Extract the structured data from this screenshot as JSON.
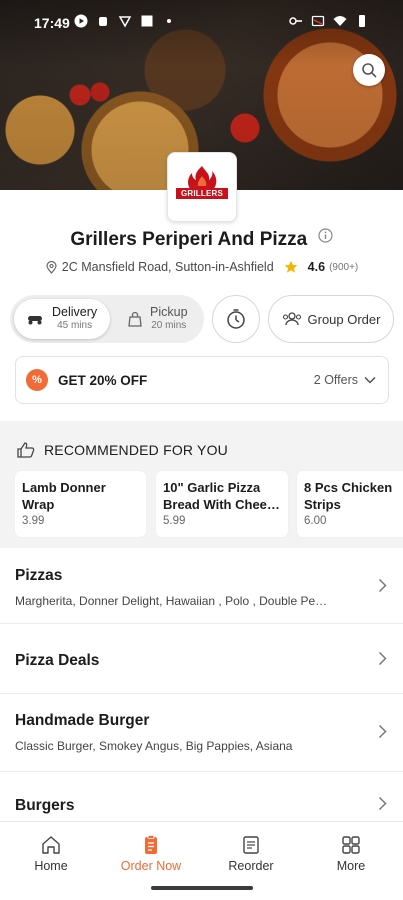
{
  "status_bar": {
    "time": "17:49",
    "left_icons": [
      "play-icon",
      "cloud-icon",
      "shield-icon",
      "square-icon",
      "dot-icon"
    ],
    "right_icons": [
      "key-icon",
      "cast-icon",
      "wifi-icon",
      "battery-icon"
    ]
  },
  "header": {
    "search_icon": "search-icon",
    "logo_text": "GRILLERS"
  },
  "restaurant": {
    "name": "Grillers Periperi And Pizza",
    "address": "2C Mansfield Road, Sutton-in-Ashfield",
    "rating": "4.6",
    "rating_count": "(900+)"
  },
  "order_mode": {
    "delivery_label": "Delivery",
    "delivery_time": "45 mins",
    "pickup_label": "Pickup",
    "pickup_time": "20 mins",
    "selected": "Delivery",
    "group_order_label": "Group Order"
  },
  "offer": {
    "badge": "%",
    "title": "GET 20% OFF",
    "count_label": "2 Offers"
  },
  "recommended": {
    "title": "RECOMMENDED FOR YOU",
    "items": [
      {
        "name": "Lamb Donner Wrap",
        "price": "3.99"
      },
      {
        "name": "10\" Garlic Pizza Bread With Chee…",
        "price": "5.99"
      },
      {
        "name": "8 Pcs Chicken Strips",
        "price": "6.00"
      }
    ]
  },
  "categories": [
    {
      "name": "Pizzas",
      "sub": "Margherita, Donner Delight, Hawaiian , Polo , Double Pe…"
    },
    {
      "name": "Pizza Deals",
      "sub": ""
    },
    {
      "name": "Handmade Burger",
      "sub": "Classic Burger, Smokey Angus, Big Pappies, Asiana"
    },
    {
      "name": "Burgers",
      "sub": ""
    }
  ],
  "bottom_nav": {
    "items": [
      {
        "label": "Home",
        "icon": "home-icon"
      },
      {
        "label": "Order Now",
        "icon": "order-icon"
      },
      {
        "label": "Reorder",
        "icon": "receipt-icon"
      },
      {
        "label": "More",
        "icon": "grid-icon"
      }
    ],
    "active": "Order Now"
  },
  "colors": {
    "accent": "#f26a35",
    "star": "#f5b400",
    "logo_red": "#c8121b"
  }
}
